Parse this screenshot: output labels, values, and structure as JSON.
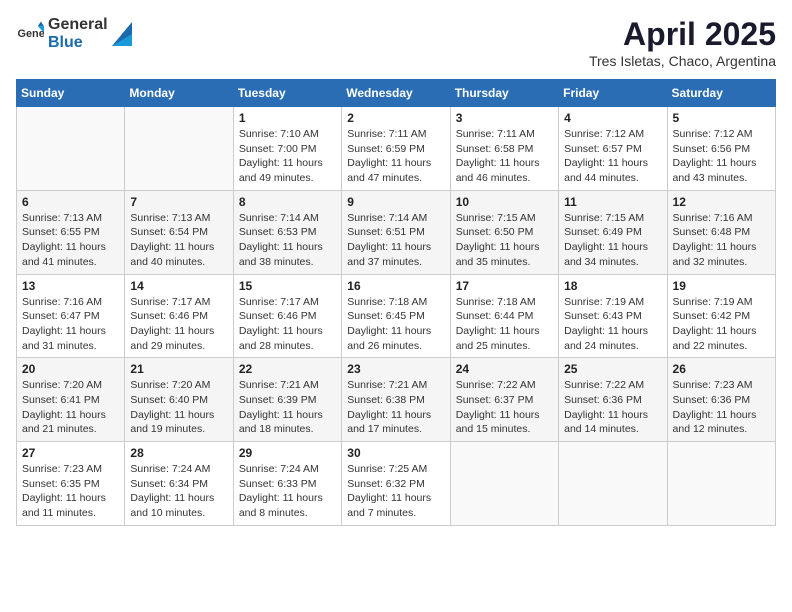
{
  "header": {
    "logo_general": "General",
    "logo_blue": "Blue",
    "title": "April 2025",
    "subtitle": "Tres Isletas, Chaco, Argentina"
  },
  "calendar": {
    "days_of_week": [
      "Sunday",
      "Monday",
      "Tuesday",
      "Wednesday",
      "Thursday",
      "Friday",
      "Saturday"
    ],
    "weeks": [
      [
        {
          "day": "",
          "detail": ""
        },
        {
          "day": "",
          "detail": ""
        },
        {
          "day": "1",
          "detail": "Sunrise: 7:10 AM\nSunset: 7:00 PM\nDaylight: 11 hours and 49 minutes."
        },
        {
          "day": "2",
          "detail": "Sunrise: 7:11 AM\nSunset: 6:59 PM\nDaylight: 11 hours and 47 minutes."
        },
        {
          "day": "3",
          "detail": "Sunrise: 7:11 AM\nSunset: 6:58 PM\nDaylight: 11 hours and 46 minutes."
        },
        {
          "day": "4",
          "detail": "Sunrise: 7:12 AM\nSunset: 6:57 PM\nDaylight: 11 hours and 44 minutes."
        },
        {
          "day": "5",
          "detail": "Sunrise: 7:12 AM\nSunset: 6:56 PM\nDaylight: 11 hours and 43 minutes."
        }
      ],
      [
        {
          "day": "6",
          "detail": "Sunrise: 7:13 AM\nSunset: 6:55 PM\nDaylight: 11 hours and 41 minutes."
        },
        {
          "day": "7",
          "detail": "Sunrise: 7:13 AM\nSunset: 6:54 PM\nDaylight: 11 hours and 40 minutes."
        },
        {
          "day": "8",
          "detail": "Sunrise: 7:14 AM\nSunset: 6:53 PM\nDaylight: 11 hours and 38 minutes."
        },
        {
          "day": "9",
          "detail": "Sunrise: 7:14 AM\nSunset: 6:51 PM\nDaylight: 11 hours and 37 minutes."
        },
        {
          "day": "10",
          "detail": "Sunrise: 7:15 AM\nSunset: 6:50 PM\nDaylight: 11 hours and 35 minutes."
        },
        {
          "day": "11",
          "detail": "Sunrise: 7:15 AM\nSunset: 6:49 PM\nDaylight: 11 hours and 34 minutes."
        },
        {
          "day": "12",
          "detail": "Sunrise: 7:16 AM\nSunset: 6:48 PM\nDaylight: 11 hours and 32 minutes."
        }
      ],
      [
        {
          "day": "13",
          "detail": "Sunrise: 7:16 AM\nSunset: 6:47 PM\nDaylight: 11 hours and 31 minutes."
        },
        {
          "day": "14",
          "detail": "Sunrise: 7:17 AM\nSunset: 6:46 PM\nDaylight: 11 hours and 29 minutes."
        },
        {
          "day": "15",
          "detail": "Sunrise: 7:17 AM\nSunset: 6:46 PM\nDaylight: 11 hours and 28 minutes."
        },
        {
          "day": "16",
          "detail": "Sunrise: 7:18 AM\nSunset: 6:45 PM\nDaylight: 11 hours and 26 minutes."
        },
        {
          "day": "17",
          "detail": "Sunrise: 7:18 AM\nSunset: 6:44 PM\nDaylight: 11 hours and 25 minutes."
        },
        {
          "day": "18",
          "detail": "Sunrise: 7:19 AM\nSunset: 6:43 PM\nDaylight: 11 hours and 24 minutes."
        },
        {
          "day": "19",
          "detail": "Sunrise: 7:19 AM\nSunset: 6:42 PM\nDaylight: 11 hours and 22 minutes."
        }
      ],
      [
        {
          "day": "20",
          "detail": "Sunrise: 7:20 AM\nSunset: 6:41 PM\nDaylight: 11 hours and 21 minutes."
        },
        {
          "day": "21",
          "detail": "Sunrise: 7:20 AM\nSunset: 6:40 PM\nDaylight: 11 hours and 19 minutes."
        },
        {
          "day": "22",
          "detail": "Sunrise: 7:21 AM\nSunset: 6:39 PM\nDaylight: 11 hours and 18 minutes."
        },
        {
          "day": "23",
          "detail": "Sunrise: 7:21 AM\nSunset: 6:38 PM\nDaylight: 11 hours and 17 minutes."
        },
        {
          "day": "24",
          "detail": "Sunrise: 7:22 AM\nSunset: 6:37 PM\nDaylight: 11 hours and 15 minutes."
        },
        {
          "day": "25",
          "detail": "Sunrise: 7:22 AM\nSunset: 6:36 PM\nDaylight: 11 hours and 14 minutes."
        },
        {
          "day": "26",
          "detail": "Sunrise: 7:23 AM\nSunset: 6:36 PM\nDaylight: 11 hours and 12 minutes."
        }
      ],
      [
        {
          "day": "27",
          "detail": "Sunrise: 7:23 AM\nSunset: 6:35 PM\nDaylight: 11 hours and 11 minutes."
        },
        {
          "day": "28",
          "detail": "Sunrise: 7:24 AM\nSunset: 6:34 PM\nDaylight: 11 hours and 10 minutes."
        },
        {
          "day": "29",
          "detail": "Sunrise: 7:24 AM\nSunset: 6:33 PM\nDaylight: 11 hours and 8 minutes."
        },
        {
          "day": "30",
          "detail": "Sunrise: 7:25 AM\nSunset: 6:32 PM\nDaylight: 11 hours and 7 minutes."
        },
        {
          "day": "",
          "detail": ""
        },
        {
          "day": "",
          "detail": ""
        },
        {
          "day": "",
          "detail": ""
        }
      ]
    ]
  }
}
